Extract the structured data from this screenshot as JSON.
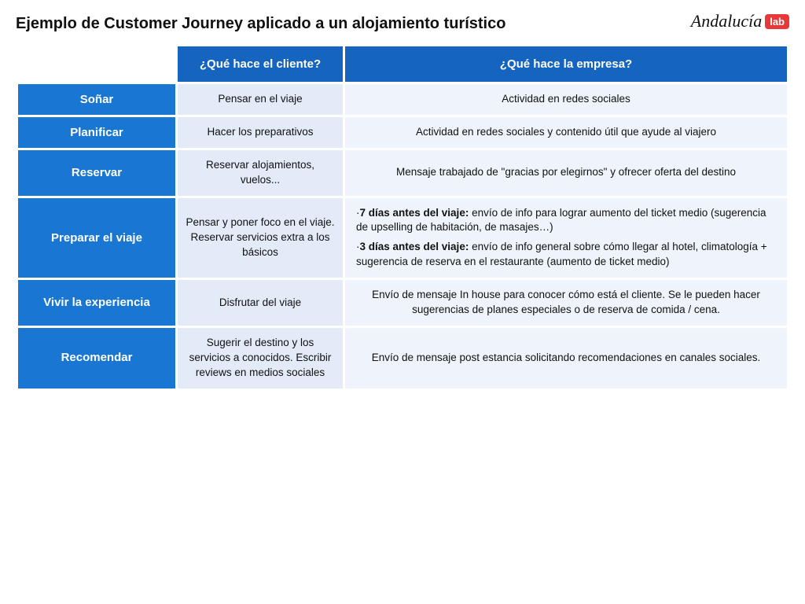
{
  "page": {
    "title": "Ejemplo de Customer Journey aplicado a un alojamiento turístico",
    "logo": {
      "text_main": "Andalucía",
      "text_lab": "lab"
    }
  },
  "table": {
    "headers": {
      "empty": "",
      "client": "¿Qué hace el cliente?",
      "company": "¿Qué hace la empresa?"
    },
    "rows": [
      {
        "stage": "Soñar",
        "client": "Pensar en el viaje",
        "company": "Actividad en redes sociales",
        "company_align": "center"
      },
      {
        "stage": "Planificar",
        "client": "Hacer los preparativos",
        "company": "Actividad en redes sociales y contenido útil que ayude al viajero",
        "company_align": "center"
      },
      {
        "stage": "Reservar",
        "client": "Reservar alojamientos, vuelos...",
        "company": "Mensaje trabajado de \"gracias por elegirnos\" y ofrecer oferta del destino",
        "company_align": "center"
      },
      {
        "stage": "Preparar el viaje",
        "client": "Pensar y poner foco en el viaje. Reservar servicios extra a los básicos",
        "company_html": true,
        "company": "·<b>7 días antes del viaje:</b> envío de info para lograr aumento del ticket medio (sugerencia de upselling de habitación, de masajes…)\n·<b>3 días antes del viaje:</b> envío de info general sobre cómo llegar al hotel, climatología + sugerencia de reserva en el restaurante (aumento de ticket medio)",
        "company_align": "left"
      },
      {
        "stage": "Vivir la experiencia",
        "client": "Disfrutar del viaje",
        "company": "Envío de mensaje In house para conocer cómo está el cliente. Se le pueden hacer sugerencias de planes especiales o de reserva de comida / cena.",
        "company_align": "center"
      },
      {
        "stage": "Recomendar",
        "client": "Sugerir el destino y los servicios a conocidos. Escribir reviews en medios sociales",
        "company": "Envío de mensaje post estancia solicitando recomendaciones en canales sociales.",
        "company_align": "center"
      }
    ]
  }
}
